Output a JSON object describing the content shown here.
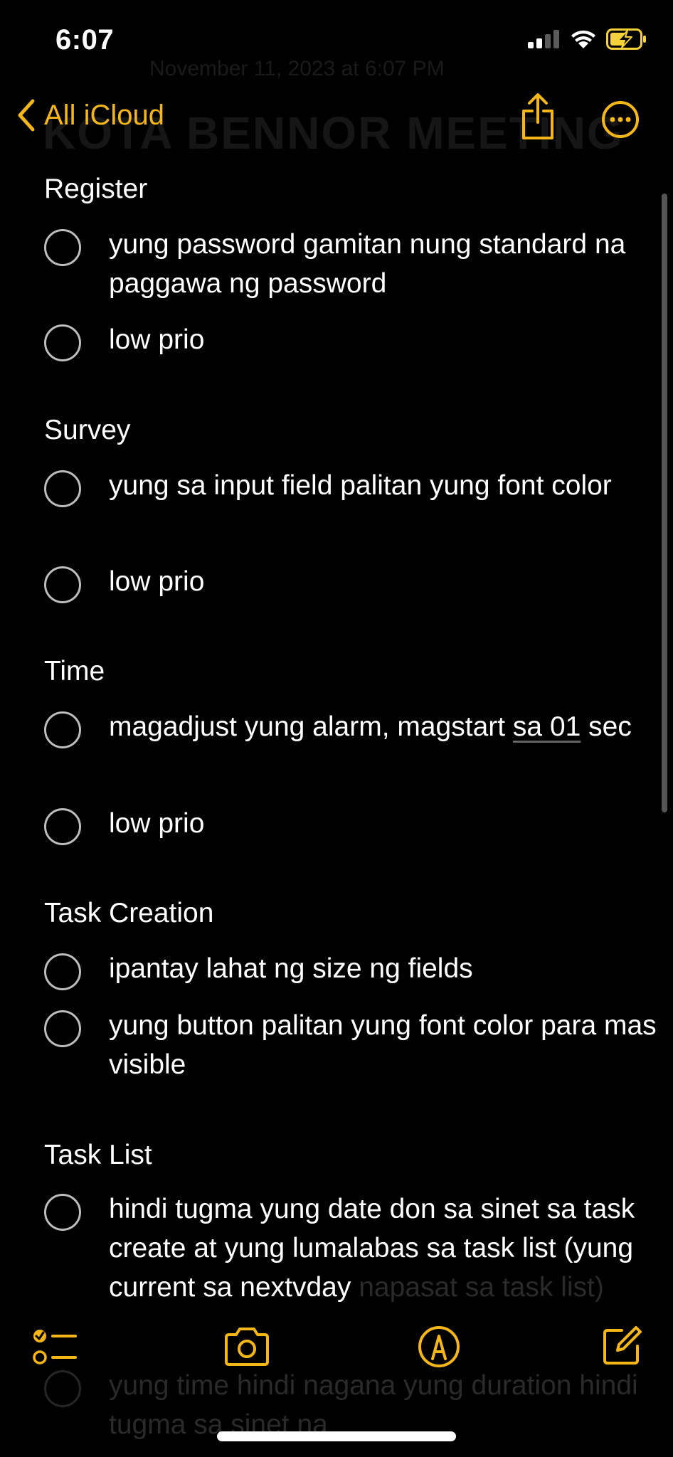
{
  "status_bar": {
    "time": "6:07"
  },
  "nav": {
    "back_label": "All iCloud",
    "ghost_date": "November 11, 2023 at 6:07 PM",
    "ghost_title": "KOTA BENNOR MEETING"
  },
  "sections": [
    {
      "title": "Register",
      "items": [
        {
          "text": "yung password gamitan nung standard na paggawa ng password"
        },
        {
          "text": "low prio"
        }
      ]
    },
    {
      "title": "Survey",
      "items": [
        {
          "text": "yung sa input field palitan yung font color"
        },
        {
          "text": "low prio"
        }
      ]
    },
    {
      "title": "Time",
      "items": [
        {
          "text_pre": "magadjust yung alarm, magstart ",
          "text_underlined": "sa 01",
          "text_post": " sec"
        },
        {
          "text": "low prio"
        }
      ]
    },
    {
      "title": "Task Creation",
      "items": [
        {
          "text": "ipantay lahat ng size ng fields"
        },
        {
          "text": "yung button palitan yung font color para mas visible"
        }
      ]
    },
    {
      "title": "Task List",
      "items": [
        {
          "text": "hindi tugma yung date don sa sinet sa task create at yung lumalabas sa task list (yung current sa nextvday",
          "faded_tail": "napasat sa task list)"
        },
        {
          "text": "yung time hindi nagana yung duration hindi tugma sa sinet na",
          "faded": true
        }
      ]
    }
  ],
  "colors": {
    "accent": "#f5b718",
    "background": "#000000",
    "text": "#ffffff"
  },
  "toolbar": {
    "icons": [
      "checklist-icon",
      "camera-icon",
      "markup-icon",
      "compose-icon"
    ]
  }
}
